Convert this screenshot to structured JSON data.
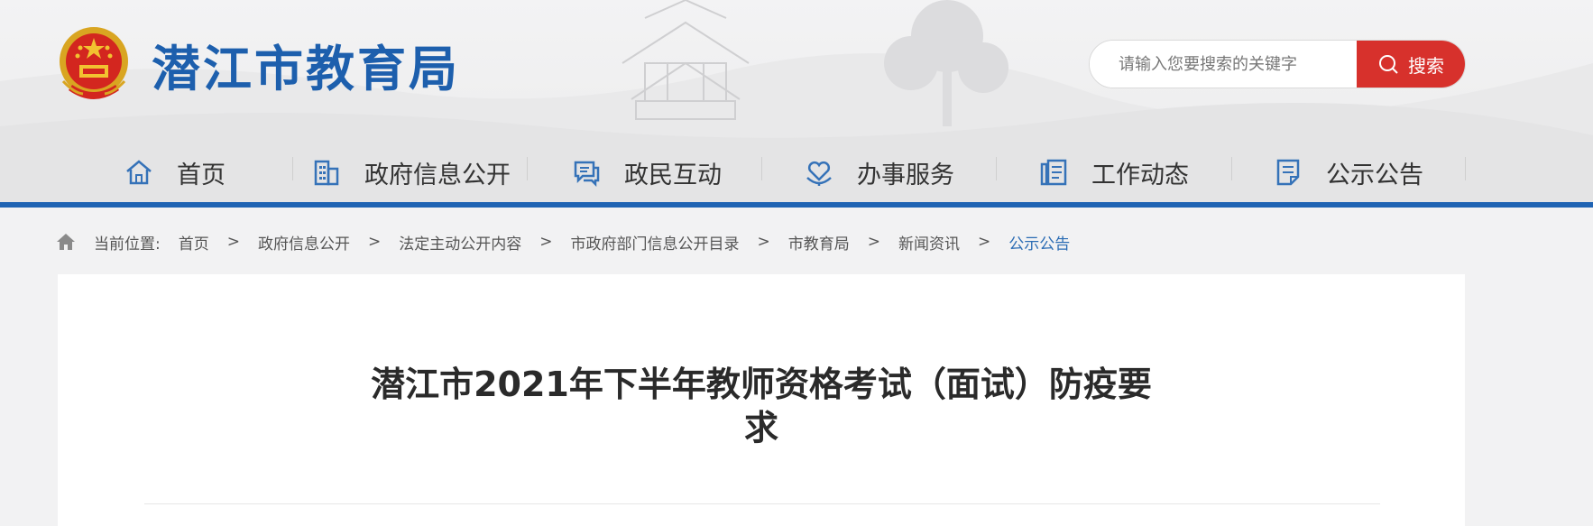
{
  "site": {
    "title": "潜江市教育局"
  },
  "search": {
    "placeholder": "请输入您要搜索的关键字",
    "button_label": "搜索"
  },
  "nav": {
    "items": [
      {
        "label": "首页",
        "icon": "home-icon"
      },
      {
        "label": "政府信息公开",
        "icon": "building-icon"
      },
      {
        "label": "政民互动",
        "icon": "chat-icon"
      },
      {
        "label": "办事服务",
        "icon": "heart-service-icon"
      },
      {
        "label": "工作动态",
        "icon": "document-list-icon"
      },
      {
        "label": "公示公告",
        "icon": "notice-icon"
      }
    ]
  },
  "breadcrumb": {
    "label": "当前位置:",
    "items": [
      "首页",
      "政府信息公开",
      "法定主动公开内容",
      "市政府部门信息公开目录",
      "市教育局",
      "新闻资讯"
    ],
    "current": "公示公告",
    "separator": ">"
  },
  "article": {
    "title": "潜江市2021年下半年教师资格考试（面试）防疫要求"
  },
  "colors": {
    "brand_blue": "#1d5fad",
    "accent_red": "#d7312c",
    "nav_line": "#1f63b3",
    "current_crumb": "#2b6cb4"
  }
}
